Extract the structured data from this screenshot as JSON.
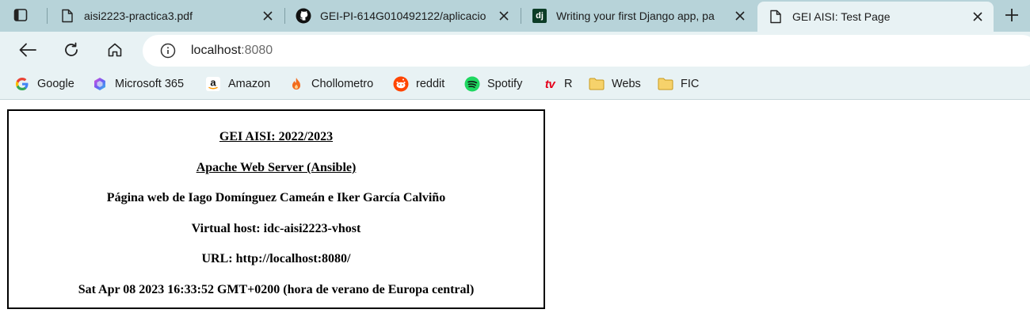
{
  "browser": {
    "tabs": [
      {
        "title": "aisi2223-practica3.pdf",
        "icon": "document-icon",
        "active": false
      },
      {
        "title": "GEI-PI-614G010492122/aplicacio",
        "icon": "github-icon",
        "active": false
      },
      {
        "title": "Writing your first Django app, pa",
        "icon": "django-icon",
        "active": false
      },
      {
        "title": "GEI AISI: Test Page",
        "icon": "document-icon",
        "active": true
      }
    ],
    "address": {
      "host": "localhost",
      "port": ":8080"
    },
    "bookmarks": [
      {
        "label": "Google",
        "icon": "google-icon"
      },
      {
        "label": "Microsoft 365",
        "icon": "microsoft365-icon"
      },
      {
        "label": "Amazon",
        "icon": "amazon-icon"
      },
      {
        "label": "Chollometro",
        "icon": "flame-icon"
      },
      {
        "label": "reddit",
        "icon": "reddit-icon"
      },
      {
        "label": "Spotify",
        "icon": "spotify-icon"
      },
      {
        "label": "R",
        "icon": "tv-icon",
        "icon_text": "tv"
      },
      {
        "label": "Webs",
        "icon": "folder-icon"
      },
      {
        "label": "FIC",
        "icon": "folder-icon"
      }
    ],
    "django_icon_text": "dj"
  },
  "page": {
    "course": "GEI AISI: 2022/2023",
    "server": "Apache Web Server (Ansible)",
    "authors": "Página web de Iago Domínguez Cameán e Iker García Calviño",
    "vhost": "Virtual host: idc-aisi2223-vhost",
    "url": "URL: http://localhost:8080/",
    "date": "Sat Apr 08 2023 16:33:52 GMT+0200 (hora de verano de Europa central)"
  },
  "colors": {
    "tabstrip": "#b7d3d9",
    "toolbar": "#e8f2f4",
    "reddit": "#ff4500",
    "spotify": "#1ed760",
    "chollometro": "#f26b1d",
    "folder": "#f4c542",
    "tv": "#e4001b"
  }
}
